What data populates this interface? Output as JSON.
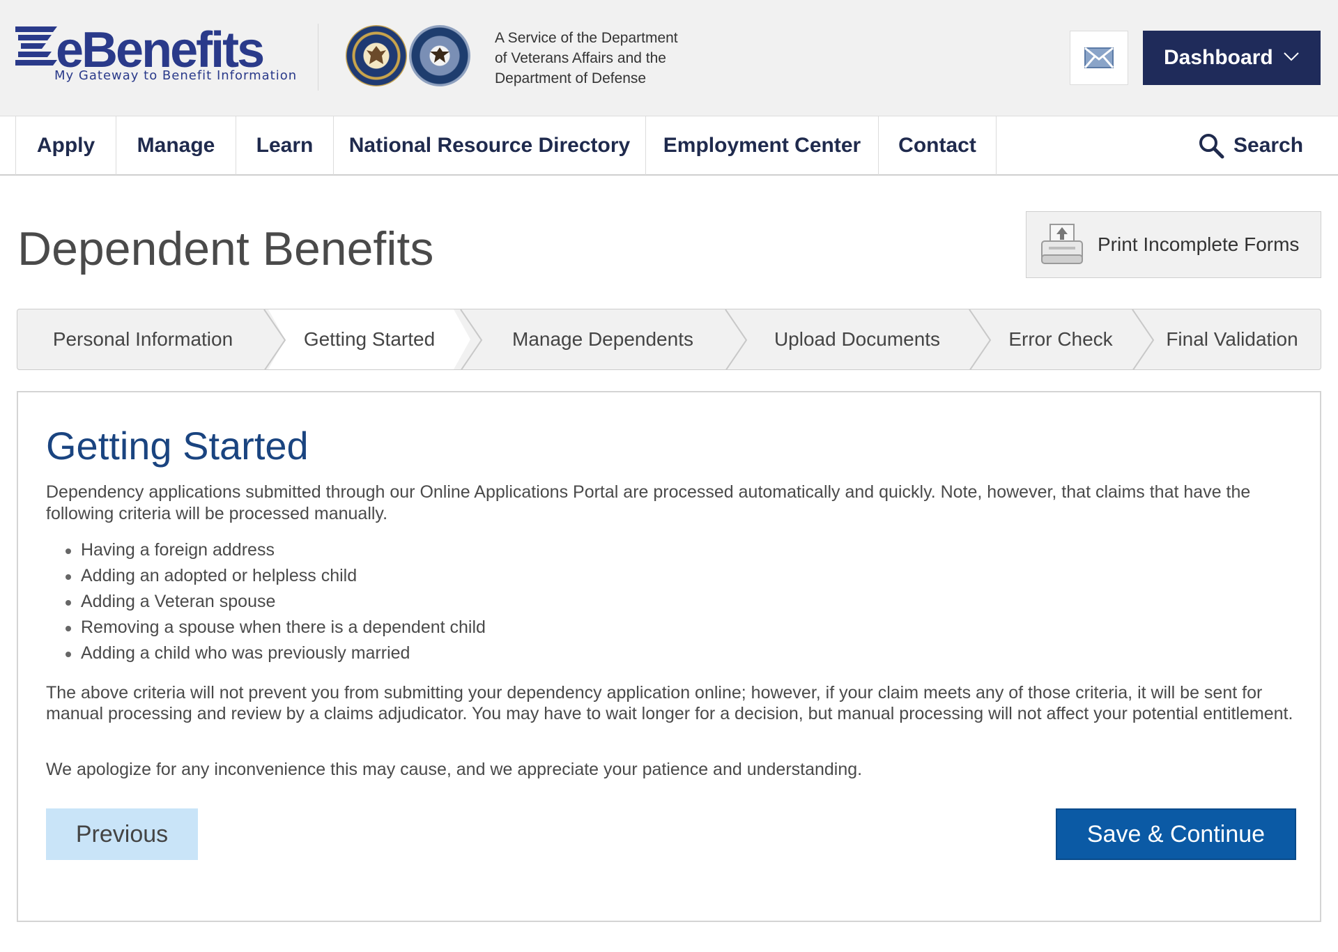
{
  "header": {
    "logo_text": "eBenefits",
    "logo_tagline": "My Gateway to Benefit Information",
    "service_line1": "A Service of the Department",
    "service_line2": "of Veterans Affairs and the",
    "service_line3": "Department of Defense",
    "mail_icon": "envelope-icon",
    "dashboard_label": "Dashboard"
  },
  "nav": {
    "items": [
      "Apply",
      "Manage",
      "Learn",
      "National Resource Directory",
      "Employment Center",
      "Contact"
    ],
    "search_label": "Search"
  },
  "page": {
    "title": "Dependent Benefits",
    "print_label": "Print Incomplete Forms"
  },
  "steps": {
    "items": [
      "Personal Information",
      "Getting Started",
      "Manage Dependents",
      "Upload Documents",
      "Error Check",
      "Final Validation"
    ],
    "active": "Getting Started"
  },
  "content": {
    "heading": "Getting Started",
    "intro": "Dependency applications submitted through our Online Applications Portal are processed automatically and quickly. Note, however, that claims that have the following criteria will be processed manually.",
    "criteria": [
      "Having a foreign address",
      "Adding an adopted or helpless child",
      "Adding a Veteran spouse",
      "Removing a spouse when there is a dependent child",
      "Adding a child who was previously married"
    ],
    "para2": "The above criteria will not prevent you from submitting your dependency application online; however, if your claim meets any of those criteria, it will be sent for manual processing and review by a claims adjudicator. You may have to wait longer for a decision, but manual processing will not affect your potential entitlement.",
    "para3": "We apologize for any inconvenience this may cause, and we appreciate your patience and understanding.",
    "previous_label": "Previous",
    "save_label": "Save & Continue"
  },
  "colors": {
    "navy": "#1f2b5a",
    "heading_blue": "#1a4480",
    "primary_button": "#0b5aa5",
    "secondary_button": "#c9e4f8"
  }
}
